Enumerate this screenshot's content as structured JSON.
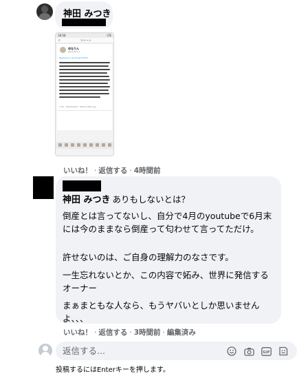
{
  "comment1": {
    "author": "神田 みつき",
    "attachment": {
      "status_time": "18:58",
      "status_icons": "LTE",
      "nav_back": "<",
      "nav_title": "ツイート",
      "tweet_author": "ゆなりん",
      "tweet_handle": "@yunarin_z",
      "replying_to": "Replying to @mimigumi830",
      "tweet_meta": "4:39 · 2020/04/29 · Twitter Web App"
    },
    "actions": {
      "like": "いいね！",
      "reply": "返信する",
      "timestamp": "4時間前"
    }
  },
  "comment2": {
    "author": "神田 みつき",
    "text_header": "ありもしないとは？",
    "paragraphs": [
      "倒産とは言ってないし、自分で4月のyoutubeで6月末には今のままなら倒産って匂わせて言ってただけ。",
      "許せないのは、ご自身の理解力のなさです。",
      "一生忘れないとか、この内容で妬み、世界に発信するオーナー",
      "まぁまともな人なら、もうヤバいとしか思いませんよ、、、"
    ],
    "actions": {
      "like": "いいね！",
      "reply": "返信する",
      "timestamp": "3時間前",
      "edited": "編集済み"
    }
  },
  "reply_box": {
    "placeholder": "返信する...",
    "hint": "投稿するにはEnterキーを押します。"
  }
}
